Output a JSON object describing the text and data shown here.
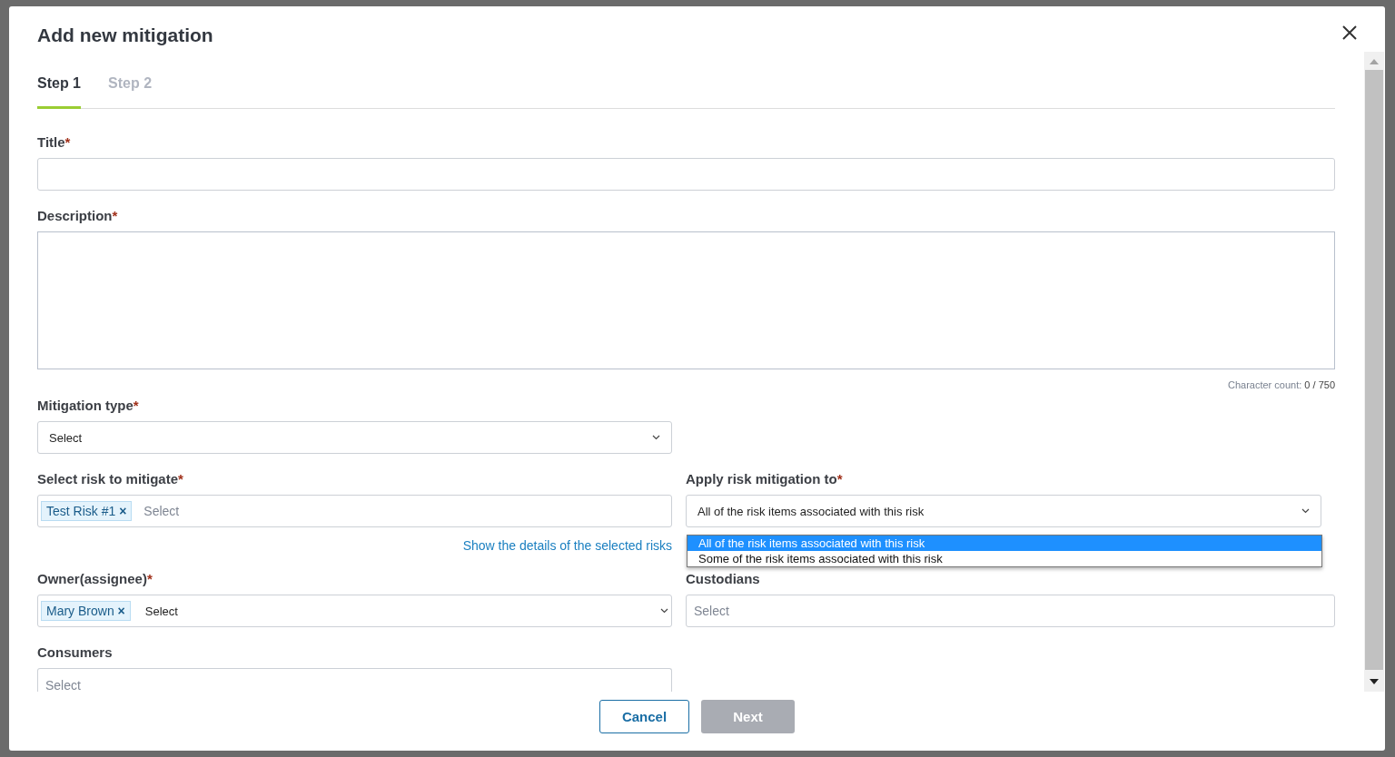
{
  "dialog": {
    "title": "Add new mitigation"
  },
  "tabs": [
    {
      "label": "Step 1",
      "selected": true
    },
    {
      "label": "Step 2",
      "selected": false
    }
  ],
  "title_field": {
    "label": "Title",
    "mark": "*"
  },
  "description_field": {
    "label": "Description",
    "mark": "*",
    "count_label": "Character count:",
    "count": "0 / 750"
  },
  "mitigation_type": {
    "label": "Mitigation type",
    "mark": "*",
    "value": "Select"
  },
  "risk_select": {
    "label": "Select risk to mitigate",
    "mark": "*",
    "tags": [
      {
        "text": "Test Risk #1",
        "remove": "×"
      }
    ],
    "placeholder": "Select",
    "link": "Show the details of the selected risks"
  },
  "apply_to": {
    "label": "Apply risk mitigation to",
    "mark": "*",
    "value": "All of the risk items associated with this risk",
    "expanded": true,
    "options": [
      {
        "text": "All of the risk items associated with this risk",
        "selected": true
      },
      {
        "text": "Some of the risk items associated with this risk",
        "selected": false
      }
    ]
  },
  "owner": {
    "label": "Owner(assignee)",
    "mark": "*",
    "tags": [
      {
        "text": "Mary Brown",
        "remove": "×"
      }
    ],
    "placeholder": "Select"
  },
  "custodians": {
    "label": "Custodians",
    "placeholder": "Select"
  },
  "consumers": {
    "label": "Consumers",
    "placeholder": "Select"
  },
  "buttons": [
    {
      "label": "Cancel",
      "kind": "secondary",
      "disabled": false
    },
    {
      "label": "Next",
      "kind": "primary",
      "disabled": true
    }
  ]
}
